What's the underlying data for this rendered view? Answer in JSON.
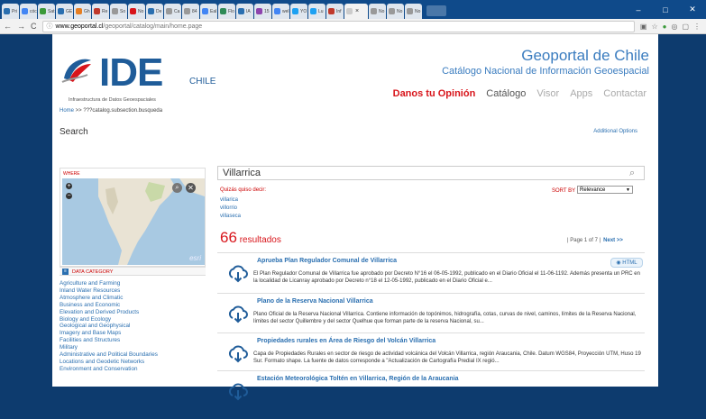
{
  "browser": {
    "tabs": [
      {
        "label": "Pri",
        "color": "#2a6fb0"
      },
      {
        "label": "cóc",
        "color": "#4285f4"
      },
      {
        "label": "Sat",
        "color": "#3a9a3a"
      },
      {
        "label": "GE",
        "color": "#2a6fb0"
      },
      {
        "label": "Gh",
        "color": "#e67e22"
      },
      {
        "label": "Re",
        "color": "#c0392b"
      },
      {
        "label": "So",
        "color": "#999999"
      },
      {
        "label": "No",
        "color": "#d8151b"
      },
      {
        "label": "De",
        "color": "#2a6fb0"
      },
      {
        "label": "Ca",
        "color": "#999999"
      },
      {
        "label": "84",
        "color": "#999999"
      },
      {
        "label": "Eal",
        "color": "#4285f4"
      },
      {
        "label": "Flo",
        "color": "#2e8b57"
      },
      {
        "label": "IA",
        "color": "#2a6fb0"
      },
      {
        "label": "15",
        "color": "#8e44ad"
      },
      {
        "label": "wel",
        "color": "#4285f4"
      },
      {
        "label": "YO",
        "color": "#1da1f2"
      },
      {
        "label": "Lu",
        "color": "#1da1f2"
      },
      {
        "label": "Inf",
        "color": "#c0392b"
      }
    ],
    "active_tab_close": "×",
    "after_tabs": [
      {
        "label": "No",
        "color": "#999999"
      },
      {
        "label": "No",
        "color": "#999999"
      },
      {
        "label": "No",
        "color": "#999999"
      }
    ],
    "window_controls": {
      "minimize": "–",
      "maximize": "□",
      "close": "✕"
    },
    "url_host": "www.geoportal.cl",
    "url_path": "/geoportal/catalog/main/home.page",
    "back": "←",
    "forward": "→",
    "reload": "C",
    "info": "ⓘ"
  },
  "header": {
    "logo_text": "IDE",
    "logo_chile": "CHILE",
    "logo_sub": "Infraestructura de Datos Geoespaciales",
    "title": "Geoportal de Chile",
    "subtitle": "Catálogo Nacional de Información Geoespacial",
    "nav": {
      "danos": "Danos tu Opinión",
      "catalogo": "Catálogo",
      "visor": "Visor",
      "apps": "Apps",
      "contactar": "Contactar"
    }
  },
  "breadcrumb": {
    "home": "Home",
    "sep": " >> ",
    "current": "???catalog.subsection.busqueda"
  },
  "search": {
    "heading": "Search",
    "additional": "Additional Options",
    "query": "Villarrica",
    "quizas": "Quizás quiso decir:",
    "suggestions": [
      "villarica",
      "villorrio",
      "villaseca"
    ],
    "sort_label": "SORT BY",
    "sort_value": "Relevance",
    "count": "66",
    "count_label": " resultados",
    "pager": "| Page 1 of 7 |",
    "next": "Next >>"
  },
  "where": {
    "label": "WHERE",
    "zoom_in": "+",
    "zoom_out": "−",
    "map_credit": "esri"
  },
  "category": {
    "heading": "DATA CATEGORY",
    "items": [
      "Agriculture and Farming",
      "Inland Water Resources",
      "Atmosphere and Climatic",
      "Business and Economic",
      "Elevation and Derived Products",
      "Biology and Ecology",
      "Geological and Geophysical",
      "Imagery and Base Maps",
      "Facilities and Structures",
      "Military",
      "Administrative and Political Boundaries",
      "Locations and Geodetic Networks",
      "Environment and Conservation"
    ]
  },
  "results": [
    {
      "title": "Aprueba Plan Regulador Comunal de Villarrica",
      "desc": "El Plan Regulador Comunal de Villarrica fue aprobado por Decreto N°16 el 06-05-1992, publicado en el Diario Oficial el 11-06-1192. Además presenta un PRC en la localidad de Licanray aprobado por Decreto n°18 el 12-05-1992, publicado en el Diario Oficial e...",
      "button": "HTML"
    },
    {
      "title": "Plano de la Reserva Nacional Villarrica",
      "desc": "Plano Oficial de la Reserva Nacional Villarrica. Contiene información de topónimos, hidrografía, cotas, curvas de nivel, caminos, límites de la Reserva Nacional, límites del sector Quillembre y del sector Quelhue que forman parte de la reserva Nacional, su...",
      "button": ""
    },
    {
      "title": "Propiedades rurales en Área de Riesgo del Volcán Villarrica",
      "desc": "Capa de Propiedades Rurales en sector de riesgo de actividad volcánica del Volcán Villarrica, región Araucania, Chile. Datum WGS84, Proyección UTM, Huso 19 Sur. Formato shape. La fuente de datos corresponde a \"Actualización de Cartografía Predial IX regió...",
      "button": ""
    },
    {
      "title": "Estación Meteorológica Toltén en Villarrica, Región de la Araucania",
      "desc": "",
      "button": ""
    }
  ]
}
